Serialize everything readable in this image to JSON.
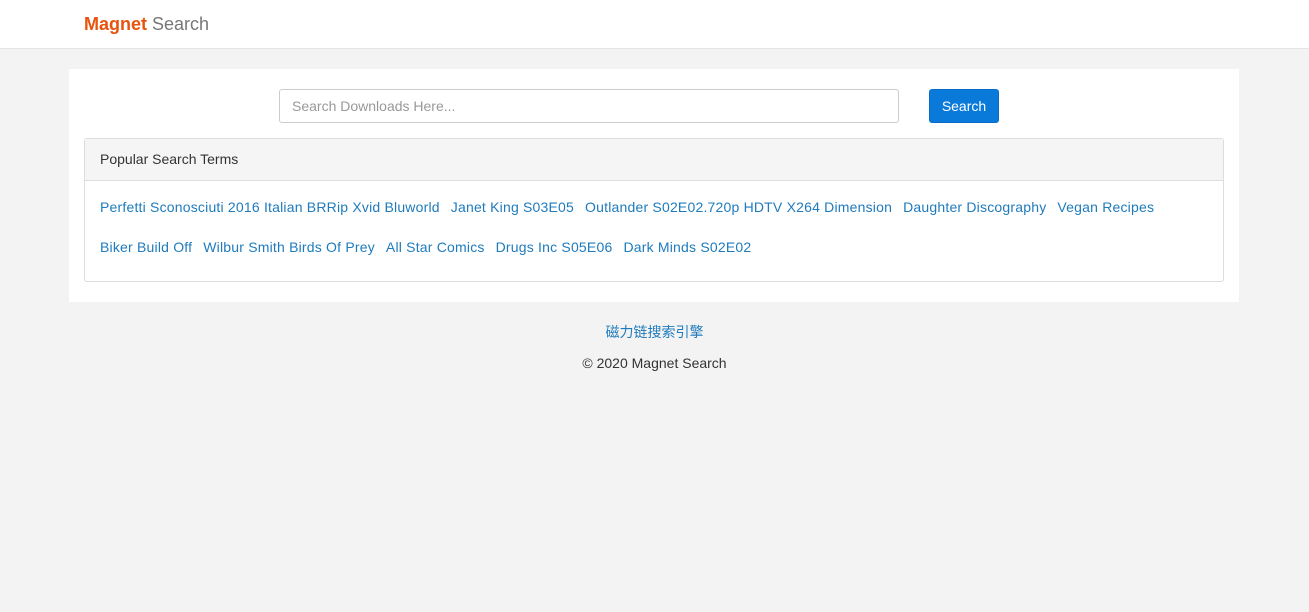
{
  "header": {
    "brand_strong": "Magnet",
    "brand_light": "Search"
  },
  "search": {
    "placeholder": "Search Downloads Here...",
    "value": "",
    "button_label": "Search"
  },
  "popular": {
    "heading": "Popular Search Terms",
    "terms": [
      "Perfetti Sconosciuti 2016 Italian BRRip Xvid Bluworld",
      "Janet King S03E05",
      "Outlander S02E02.720p HDTV X264 Dimension",
      "Daughter Discography",
      "Vegan Recipes",
      "Biker Build Off",
      "Wilbur Smith Birds Of Prey",
      "All Star Comics",
      "Drugs Inc S05E06",
      "Dark Minds S02E02"
    ]
  },
  "footer": {
    "link_text": "磁力链搜索引擎",
    "copyright": "© 2020 Magnet Search"
  },
  "colors": {
    "brand_accent": "#e8530e",
    "link": "#1f7bbd",
    "primary_button": "#0a7ada",
    "page_background": "#f3f3f3"
  }
}
